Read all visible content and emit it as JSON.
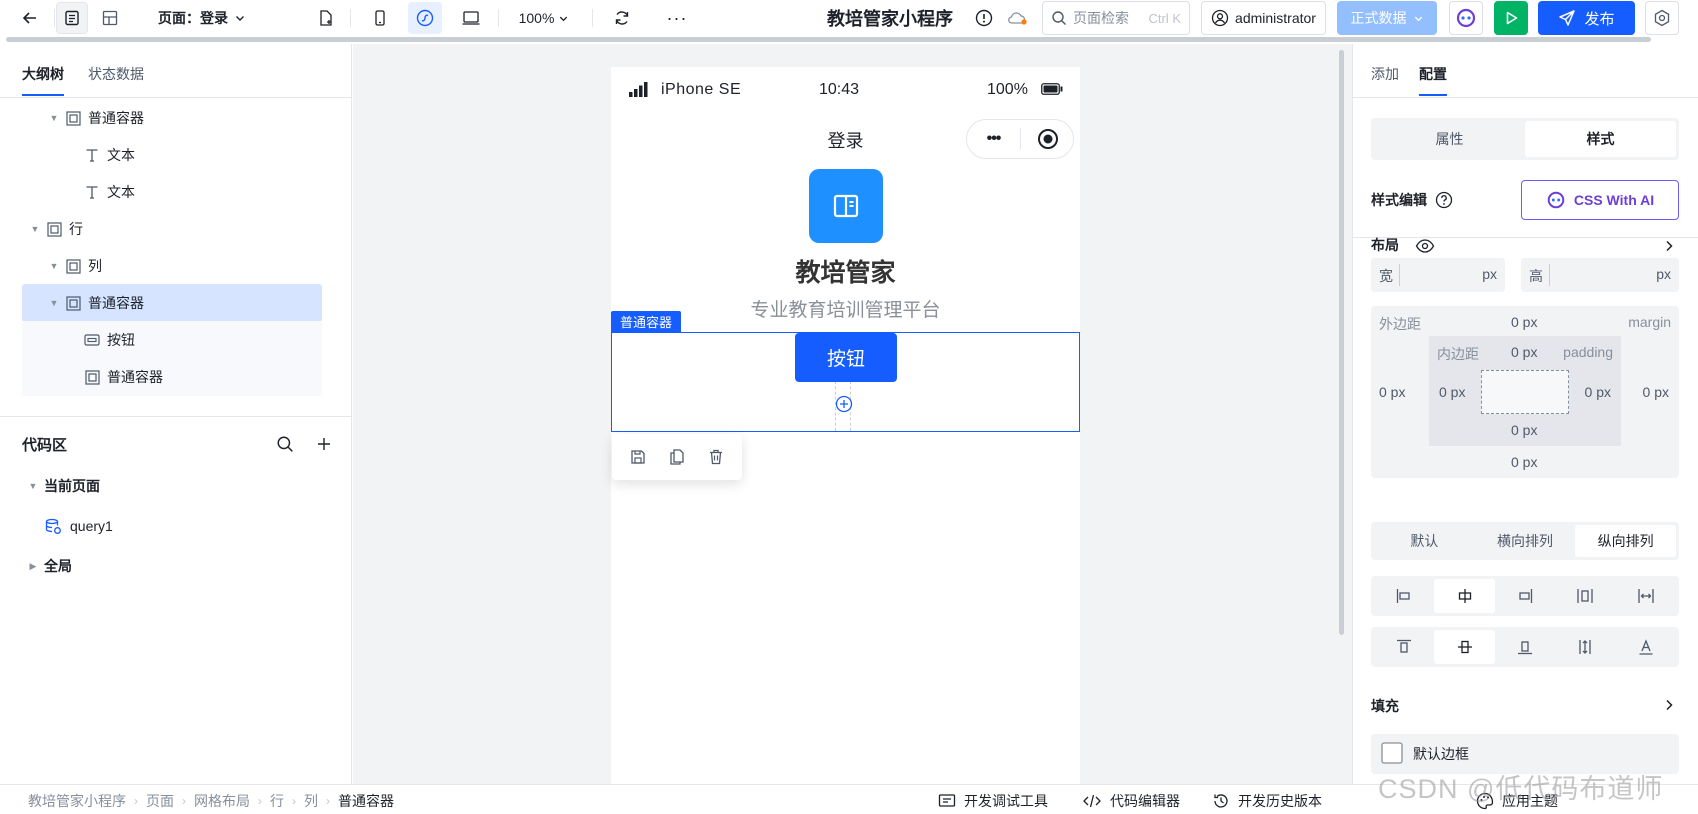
{
  "topbar": {
    "page_label": "页面：登录",
    "zoom": "100%",
    "app_title": "教培管家小程序",
    "search_placeholder": "页面检索",
    "search_shortcut": "Ctrl K",
    "user": "administrator",
    "env": "正式数据",
    "publish": "发布"
  },
  "left": {
    "tabs": [
      "大纲树",
      "状态数据"
    ],
    "tree": [
      {
        "label": "普通容器",
        "icon": "container-icon",
        "indent": 3,
        "caret": true
      },
      {
        "label": "文本",
        "icon": "text-icon",
        "indent": 4,
        "caret": false
      },
      {
        "label": "文本",
        "icon": "text-icon",
        "indent": 4,
        "caret": false
      },
      {
        "label": "行",
        "icon": "container-icon",
        "indent": 2,
        "caret": true
      },
      {
        "label": "列",
        "icon": "container-icon",
        "indent": 3,
        "caret": true
      },
      {
        "label": "普通容器",
        "icon": "container-icon",
        "indent": 3,
        "caret": true,
        "selected": true
      },
      {
        "label": "按钮",
        "icon": "button-icon",
        "indent": 4,
        "caret": false,
        "child": true
      },
      {
        "label": "普通容器",
        "icon": "container-icon",
        "indent": 4,
        "caret": false,
        "child": true
      }
    ],
    "code_title": "代码区",
    "current_page": "当前页面",
    "query": "query1",
    "global": "全局"
  },
  "phone": {
    "device": "iPhone SE",
    "time": "10:43",
    "battery": "100%",
    "nav_title": "登录",
    "app_name": "教培管家",
    "subtitle": "专业教育培训管理平台",
    "selection_tag": "普通容器",
    "button": "按钮"
  },
  "right": {
    "tabs": [
      "添加",
      "配置"
    ],
    "seg": [
      "属性",
      "样式"
    ],
    "style_edit": "样式编辑",
    "css_ai": "CSS With AI",
    "layout": "布局",
    "width_label": "宽",
    "height_label": "高",
    "unit": "px",
    "margin_label": "外边距",
    "margin_en": "margin",
    "padding_label": "内边距",
    "padding_en": "padding",
    "zero": "0 px",
    "direction": [
      "默认",
      "横向排列",
      "纵向排列"
    ],
    "fill": "填充",
    "default_border": "默认边框"
  },
  "bottom": {
    "crumbs": [
      "教培管家小程序",
      "页面",
      "网格布局",
      "行",
      "列",
      "普通容器"
    ],
    "dev_tools": "开发调试工具",
    "code_editor": "代码编辑器",
    "history": "开发历史版本",
    "theme": "应用主题"
  },
  "watermark": "CSDN @低代码布道师",
  "colors": {
    "primary": "#165dff",
    "green": "#00b365",
    "logo": "#1e90ff"
  }
}
